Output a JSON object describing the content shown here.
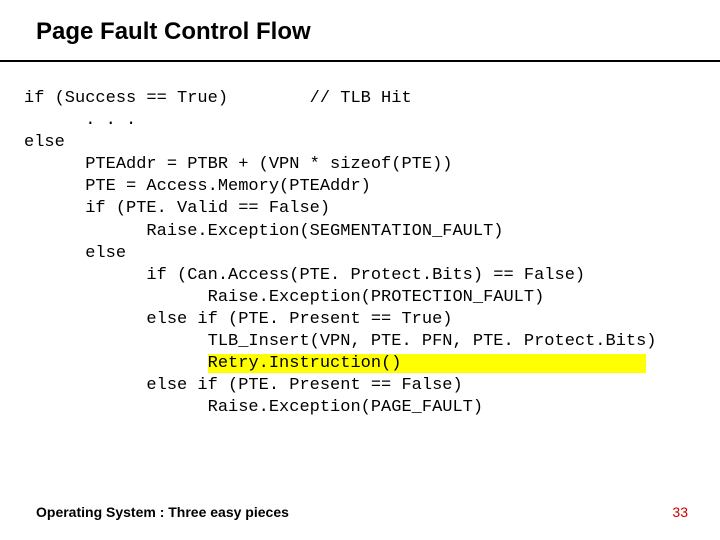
{
  "title": "Page Fault Control Flow",
  "code": {
    "l01": "if (Success == True)        // TLB Hit",
    "l02": "      . . .",
    "l03": "else",
    "l04": "      PTEAddr = PTBR + (VPN * sizeof(PTE))",
    "l05": "      PTE = Access.Memory(PTEAddr)",
    "l06": "      if (PTE. Valid == False)",
    "l07": "            Raise.Exception(SEGMENTATION_FAULT)",
    "l08": "      else",
    "l09": "            if (Can.Access(PTE. Protect.Bits) == False)",
    "l10": "                  Raise.Exception(PROTECTION_FAULT)",
    "l11": "            else if (PTE. Present == True)",
    "l12": "                  TLB_Insert(VPN, PTE. PFN, PTE. Protect.Bits)",
    "l13_pad": "                  ",
    "l13_hl": "Retry.Instruction()                        ",
    "l14": "            else if (PTE. Present == False)",
    "l15": "                  Raise.Exception(PAGE_FAULT)"
  },
  "footer": {
    "left": "Operating System : Three easy pieces",
    "right": "33"
  }
}
